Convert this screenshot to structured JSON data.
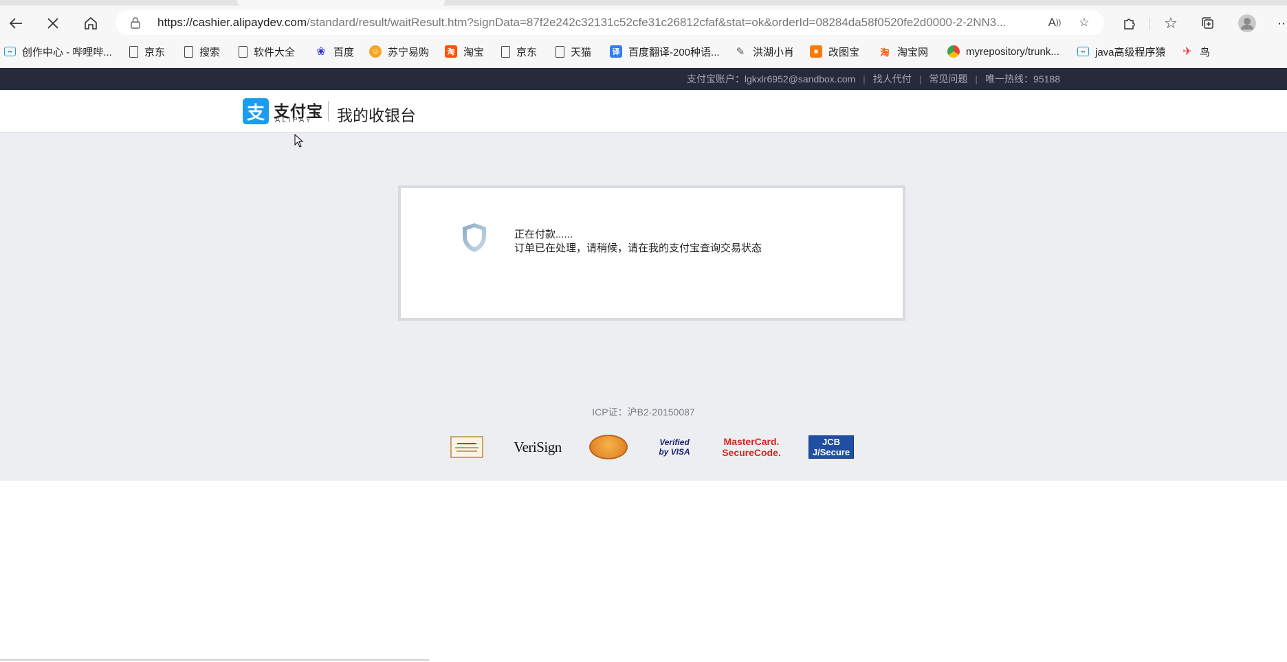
{
  "browser": {
    "url_host": "https://cashier.alipaydev.com",
    "url_path": "/standard/result/waitResult.htm?signData=87f2e242c32131c52cfe31c26812cfaf&stat=ok&orderId=08284da58f0520fe2d0000-2-2NN3..."
  },
  "bookmarks": [
    {
      "label": "创作中心 - 哔哩哔...",
      "icon": "bilibili-icon",
      "color": "#1e9bd6"
    },
    {
      "label": "京东",
      "icon": "page-icon",
      "color": "#333333"
    },
    {
      "label": "搜索",
      "icon": "page-icon",
      "color": "#333333"
    },
    {
      "label": "软件大全",
      "icon": "page-icon",
      "color": "#333333"
    },
    {
      "label": "百度",
      "icon": "baidu-icon",
      "color": "#2932e1"
    },
    {
      "label": "苏宁易购",
      "icon": "suning-icon",
      "color": "#f5a623"
    },
    {
      "label": "淘宝",
      "icon": "taobao-icon",
      "color": "#ff5000"
    },
    {
      "label": "京东",
      "icon": "page-icon",
      "color": "#333333"
    },
    {
      "label": "天猫",
      "icon": "page-icon",
      "color": "#333333"
    },
    {
      "label": "百度翻译-200种语...",
      "icon": "baidu-translate-icon",
      "color": "#2f7ef5"
    },
    {
      "label": "洪湖小肖",
      "icon": "bird-icon",
      "color": "#555555"
    },
    {
      "label": "改图宝",
      "icon": "gaitubao-icon",
      "color": "#ff7a00"
    },
    {
      "label": "淘宝网",
      "icon": "taobao-icon",
      "color": "#ff5000"
    },
    {
      "label": "myrepository/trunk...",
      "icon": "chrome-icon",
      "color": "#4285f4"
    },
    {
      "label": "java高级程序猿",
      "icon": "bilibili-icon",
      "color": "#1e9bd6"
    },
    {
      "label": "鸟",
      "icon": "bird-icon",
      "color": "#e53935"
    }
  ],
  "topnav": {
    "account": "支付宝账户：lgkxlr6952@sandbox.com",
    "find_payer": "找人代付",
    "faq": "常见问题",
    "hotline": "唯一热线：95188"
  },
  "header": {
    "logo_char": "支",
    "logo_cn": "支付宝",
    "logo_en": "ALIPAY",
    "title": "我的收银台"
  },
  "status": {
    "title": "正在付款......",
    "description": "订单已在处理，请稍候，请在我的支付宝查询交易状态"
  },
  "footer": {
    "icp": "ICP证：沪B2-20150087",
    "certs": [
      "VeriSign",
      "Verified by VISA",
      "MasterCard. SecureCode.",
      "JCB J/Secure"
    ]
  },
  "colors": {
    "nav_bg": "#262a3a",
    "alipay_blue": "#1a9cf0",
    "page_bg": "#eceef1"
  }
}
